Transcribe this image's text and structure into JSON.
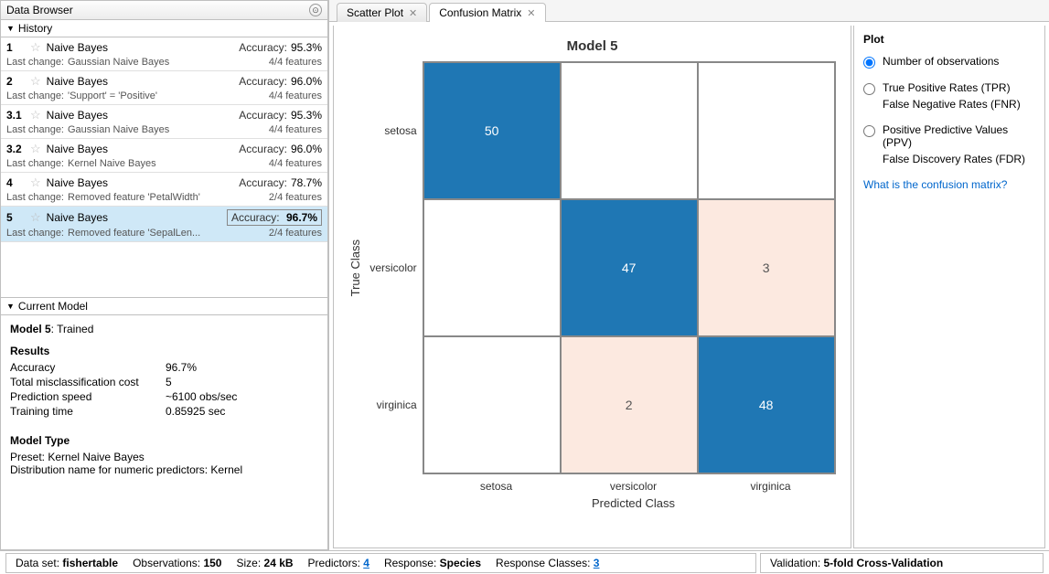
{
  "left": {
    "panel_title": "Data Browser",
    "history_header": "History",
    "lastchange_label": "Last change:",
    "accuracy_label": "Accuracy:",
    "items": [
      {
        "num": "1",
        "name": "Naive Bayes",
        "acc": "95.3%",
        "change": "Gaussian Naive Bayes",
        "feat": "4/4 features",
        "selected": false
      },
      {
        "num": "2",
        "name": "Naive Bayes",
        "acc": "96.0%",
        "change": "'Support' = 'Positive'",
        "feat": "4/4 features",
        "selected": false
      },
      {
        "num": "3.1",
        "name": "Naive Bayes",
        "acc": "95.3%",
        "change": "Gaussian Naive Bayes",
        "feat": "4/4 features",
        "selected": false
      },
      {
        "num": "3.2",
        "name": "Naive Bayes",
        "acc": "96.0%",
        "change": "Kernel Naive Bayes",
        "feat": "4/4 features",
        "selected": false
      },
      {
        "num": "4",
        "name": "Naive Bayes",
        "acc": "78.7%",
        "change": "Removed feature 'PetalWidth'",
        "feat": "2/4 features",
        "selected": false
      },
      {
        "num": "5",
        "name": "Naive Bayes",
        "acc": "96.7%",
        "change": "Removed feature 'SepalLen...",
        "feat": "2/4 features",
        "selected": true
      }
    ],
    "current_header": "Current Model",
    "cm_title_model": "Model 5",
    "cm_title_state": ": Trained",
    "results_h": "Results",
    "results": [
      {
        "k": "Accuracy",
        "v": "96.7%"
      },
      {
        "k": "Total misclassification cost",
        "v": "5"
      },
      {
        "k": "Prediction speed",
        "v": "~6100 obs/sec"
      },
      {
        "k": "Training time",
        "v": "0.85925 sec"
      }
    ],
    "modeltype_h": "Model Type",
    "modeltype_lines": [
      "Preset: Kernel Naive Bayes",
      "Distribution name for numeric predictors: Kernel"
    ]
  },
  "tabs": [
    {
      "label": "Scatter Plot",
      "active": false
    },
    {
      "label": "Confusion Matrix",
      "active": true
    }
  ],
  "plot": {
    "title": "Model 5",
    "ylabel": "True Class",
    "xlabel": "Predicted Class",
    "classes": [
      "setosa",
      "versicolor",
      "virginica"
    ]
  },
  "chart_data": {
    "type": "heatmap",
    "title": "Model 5",
    "xlabel": "Predicted Class",
    "ylabel": "True Class",
    "categories": [
      "setosa",
      "versicolor",
      "virginica"
    ],
    "matrix": [
      [
        50,
        0,
        0
      ],
      [
        0,
        47,
        3
      ],
      [
        0,
        2,
        48
      ]
    ]
  },
  "plot_side": {
    "header": "Plot",
    "opt1": "Number of observations",
    "opt2a": "True Positive Rates (TPR)",
    "opt2b": "False Negative Rates (FNR)",
    "opt3a": "Positive Predictive Values (PPV)",
    "opt3b": "False Discovery Rates (FDR)",
    "help": "What is the confusion matrix?"
  },
  "status": {
    "dataset_lbl": "Data set:",
    "dataset": "fishertable",
    "obs_lbl": "Observations:",
    "obs": "150",
    "size_lbl": "Size:",
    "size": "24 kB",
    "pred_lbl": "Predictors:",
    "pred": "4",
    "resp_lbl": "Response:",
    "resp": "Species",
    "rc_lbl": "Response Classes:",
    "rc": "3",
    "val_lbl": "Validation:",
    "val": "5-fold Cross-Validation"
  }
}
